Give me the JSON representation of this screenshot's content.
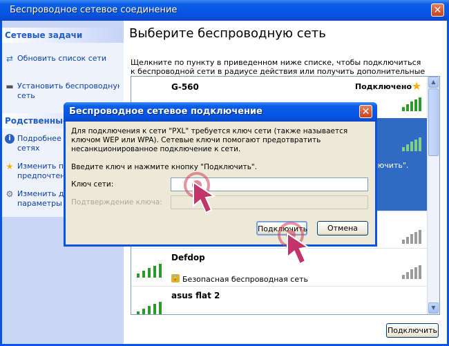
{
  "window": {
    "title": "Беспроводное сетевое соединение",
    "close_glyph": "✕"
  },
  "sidebar": {
    "tasks_header": "Сетевые задачи",
    "tasks": [
      {
        "label": "Обновить список сети",
        "icon": "refresh-icon"
      },
      {
        "label": "Установить беспроводную",
        "label2": "сеть",
        "icon": "network-setup-icon"
      }
    ],
    "related_header": "Родственные з",
    "related": [
      {
        "label": "Подробнее о",
        "label2": "сетях",
        "icon": "info-icon"
      },
      {
        "label": "Изменить пор",
        "label2": "предпочтени",
        "icon": "star-icon"
      },
      {
        "label": "Изменить доп",
        "label2": "параметры",
        "icon": "gear-icon"
      }
    ]
  },
  "main": {
    "heading": "Выберите беспроводную сеть",
    "instruction": "Щелкните по пункту в приведенном ниже списке, чтобы подключиться к беспроводной сети в радиусе действия или получить дополнительные сведения.",
    "connect_button": "Подключить",
    "networks": [
      {
        "name": "G-560",
        "status": "Подключено",
        "security": ""
      },
      {
        "name": "",
        "status": "",
        "security": "",
        "fragment": "лючить\"."
      },
      {
        "name": "",
        "status": "",
        "security": ""
      },
      {
        "name": "Defdop",
        "status": "",
        "security": "Безопасная беспроводная сеть"
      },
      {
        "name": "asus flat 2",
        "status": "",
        "security": ""
      }
    ]
  },
  "dialog": {
    "title": "Беспроводное сетевое подключение",
    "description": "Для подключения к сети \"PXL\" требуется ключ сети (также называется ключом WEP или WPA). Сетевые ключи помогают предотвратить несанкционированное подключение к сети.",
    "prompt": "Введите ключ и нажмите кнопку \"Подключить\".",
    "key_label": "Ключ сети:",
    "key_value": "",
    "confirm_label": "Подтверждение ключа:",
    "connect_button": "Подключить",
    "cancel_button": "Отмена"
  },
  "colors": {
    "titlebar": "#0554e3",
    "sidebar": "#c9d6f5",
    "selection": "#316ac5",
    "signal": "#2b9a2b",
    "tap_marker": "#d23c5a"
  }
}
